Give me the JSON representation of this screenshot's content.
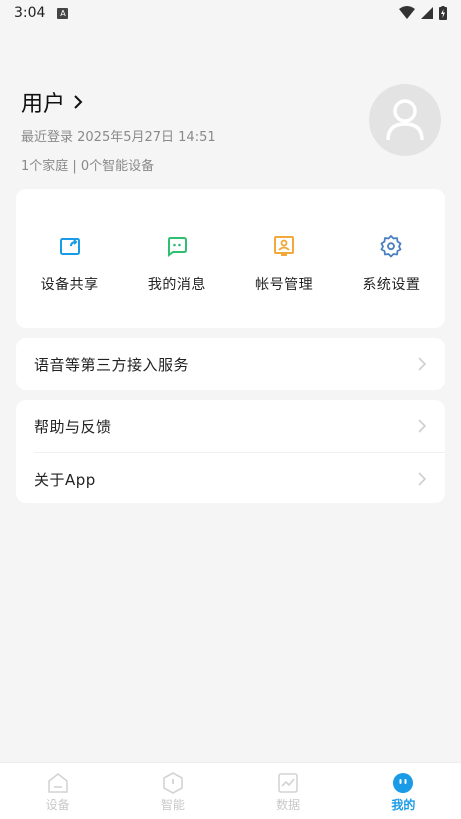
{
  "status_bar": {
    "time": "3:04",
    "notification_glyph": "A"
  },
  "profile": {
    "name": "用户",
    "last_login": "最近登录 2025年5月27日 14:51",
    "summary": "1个家庭 | 0个智能设备"
  },
  "quick_actions": [
    {
      "label": "设备共享",
      "icon": "share-device-icon",
      "color": "#1a9be8"
    },
    {
      "label": "我的消息",
      "icon": "message-icon",
      "color": "#2fbf71"
    },
    {
      "label": "帐号管理",
      "icon": "account-icon",
      "color": "#f2a93b"
    },
    {
      "label": "系统设置",
      "icon": "gear-icon",
      "color": "#4a7fc1"
    }
  ],
  "menu": {
    "voice_services": "语音等第三方接入服务",
    "help_feedback": "帮助与反馈",
    "about": "关于App"
  },
  "tabs": [
    {
      "label": "设备",
      "icon": "home-icon",
      "active": false
    },
    {
      "label": "智能",
      "icon": "smart-icon",
      "active": false
    },
    {
      "label": "数据",
      "icon": "chart-icon",
      "active": false
    },
    {
      "label": "我的",
      "icon": "me-icon",
      "active": true
    }
  ],
  "colors": {
    "accent": "#1a9be8",
    "background": "#f5f5f5"
  }
}
